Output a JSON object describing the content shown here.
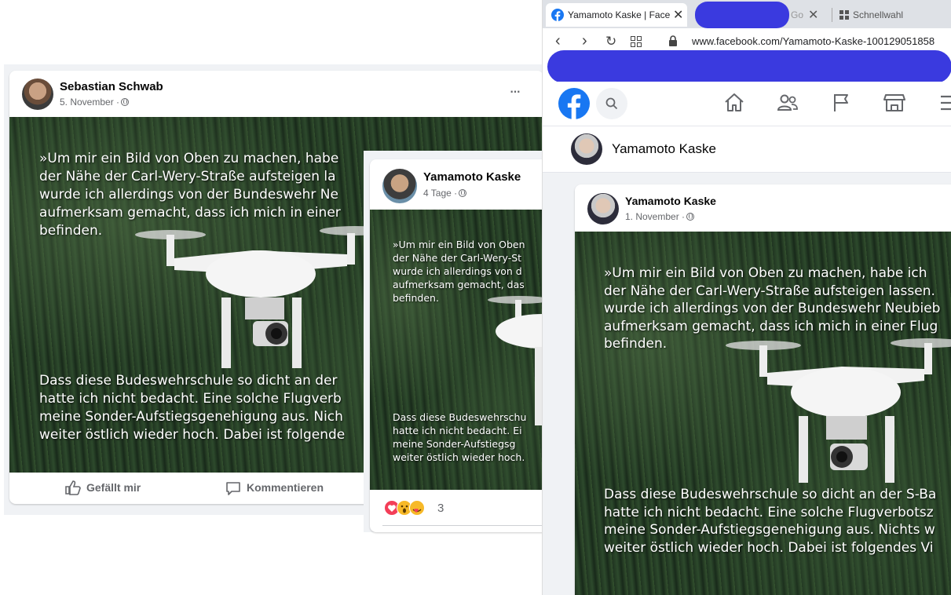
{
  "post_left": {
    "author": "Sebastian Schwab",
    "date": "5. November ·",
    "text_top": "»Um mir ein Bild von Oben zu machen, habe\nder Nähe der Carl-Wery-Straße aufsteigen la\nwurde ich allerdings von der Bundeswehr Ne\naufmerksam gemacht, dass ich mich in einer\nbefinden.",
    "text_bottom": "Dass diese Budeswehrschule so dicht an der\nhatte ich nicht bedacht. Eine solche Flugverb\nmeine Sonder-Aufstiegsgenehigung aus. Nich\nweiter östlich wieder hoch. Dabei ist folgende",
    "like_label": "Gefällt mir",
    "comment_label": "Kommentieren",
    "more_label": "···"
  },
  "post_middle": {
    "author": "Yamamoto Kaske",
    "date": "4 Tage ·",
    "text_top": "»Um mir ein Bild von Oben\nder Nähe der Carl-Wery-St\nwurde ich allerdings von d\naufmerksam gemacht, das\nbefinden.",
    "text_bottom": "Dass diese Budeswehrschu\nhatte ich nicht bedacht. Ei\nmeine Sonder-Aufstiegsg\nweiter östlich wieder hoch.",
    "reaction_count": "3"
  },
  "browser": {
    "tab_active_title": "Yamamoto Kaske | Faceb",
    "tab_second_title": "Go",
    "bookmarks_label": "Schnellwahl",
    "url": "www.facebook.com/Yamamoto-Kaske-100129051858",
    "page_name": "Yamamoto Kaske"
  },
  "post_right": {
    "author": "Yamamoto Kaske",
    "date": "1. November ·",
    "text_top": "»Um mir ein Bild von Oben zu machen, habe ich\nder Nähe der Carl-Wery-Straße aufsteigen lassen.\nwurde ich allerdings von der Bundeswehr Neubieb\naufmerksam gemacht, dass ich mich in einer Flug\nbefinden.",
    "text_bottom": "Dass diese Budeswehrschule so dicht an der S-Ba\nhatte ich nicht bedacht. Eine solche Flugverbotsz\nmeine Sonder-Aufstiegsgenehigung aus. Nichts w\nweiter östlich wieder hoch. Dabei ist folgendes Vi"
  },
  "colors": {
    "facebook_blue": "#1877f2",
    "scribble_blue": "#3a3adf",
    "panel_bg": "#f0f2f5"
  },
  "icons": [
    "more-icon",
    "like-icon",
    "comment-icon",
    "globe-icon",
    "facebook-logo",
    "search-icon",
    "home-icon",
    "friends-icon",
    "pages-flag-icon",
    "marketplace-icon",
    "menu-icon",
    "back-icon",
    "forward-icon",
    "reload-icon",
    "grid-icon",
    "lock-icon",
    "close-icon",
    "love-reaction-icon",
    "wow-reaction-icon"
  ]
}
